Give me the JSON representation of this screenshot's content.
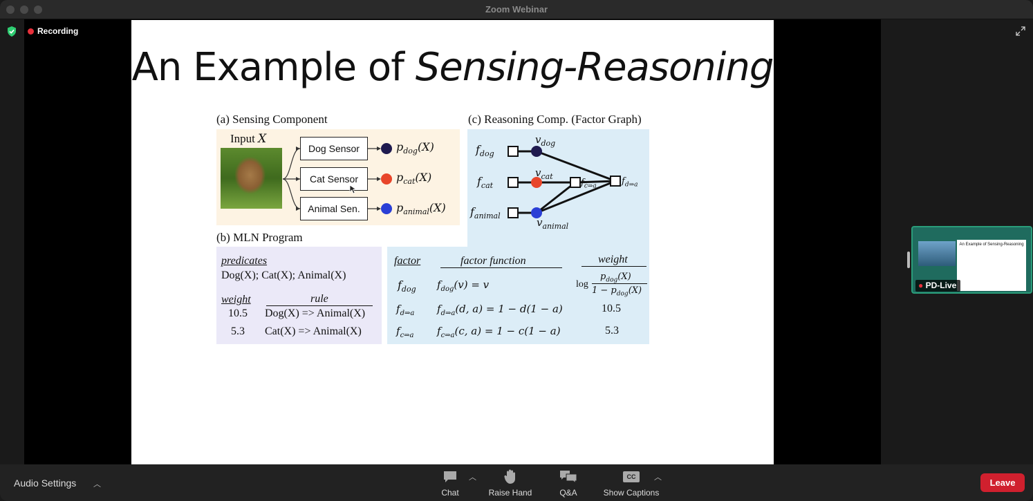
{
  "window": {
    "title": "Zoom Webinar"
  },
  "status": {
    "recording_label": "Recording"
  },
  "slide": {
    "title_plain": "An Example of ",
    "title_italic": "Sensing-Reasoning",
    "panel_a": {
      "heading": "(a) Sensing Component",
      "input_label": "Input ",
      "input_var": "X",
      "sensors": [
        "Dog Sensor",
        "Cat Sensor",
        "Animal Sen."
      ],
      "outputs": [
        "p_dog(X)",
        "p_cat(X)",
        "p_animal(X)"
      ]
    },
    "panel_b": {
      "heading": "(b) MLN Program",
      "predicates_header": "predicates",
      "predicates": "Dog(X); Cat(X); Animal(X)",
      "weight_header": "weight",
      "rule_header": "rule",
      "rules": [
        {
          "weight": "10.5",
          "rule": "Dog(X) => Animal(X)"
        },
        {
          "weight": "5.3",
          "rule": "Cat(X) => Animal(X)"
        }
      ]
    },
    "panel_c": {
      "heading": "(c) Reasoning Comp. (Factor Graph)",
      "factors": [
        "f_dog",
        "f_cat",
        "f_animal",
        "f_c⇒a",
        "f_d⇒a"
      ],
      "variables": [
        "v_dog",
        "v_cat",
        "v_animal"
      ]
    },
    "factor_table": {
      "headers": [
        "factor",
        "factor function",
        "weight"
      ],
      "rows": [
        {
          "factor": "f_dog",
          "function": "f_dog(v) = v",
          "weight": "log p_dog(X) / (1 − p_dog(X))"
        },
        {
          "factor": "f_d⇒a",
          "function": "f_d⇒a(d, a) = 1 − d(1 − a)",
          "weight": "10.5"
        },
        {
          "factor": "f_c⇒a",
          "function": "f_c⇒a(c, a) = 1 − c(1 − a)",
          "weight": "5.3"
        }
      ]
    }
  },
  "participant": {
    "name": "PD-Live",
    "mini_slide_title": "An Example of Sensing-Reasoning"
  },
  "toolbar": {
    "audio_settings": "Audio Settings",
    "chat": "Chat",
    "raise_hand": "Raise Hand",
    "qa": "Q&A",
    "show_captions": "Show Captions",
    "leave": "Leave",
    "cc_badge": "CC"
  },
  "colors": {
    "leave": "#d0202e",
    "recording": "#e8303b",
    "shield": "#2ecc71",
    "node_dog": "#1f1a4f",
    "node_cat": "#e8452a",
    "node_animal": "#2a3fd6"
  }
}
